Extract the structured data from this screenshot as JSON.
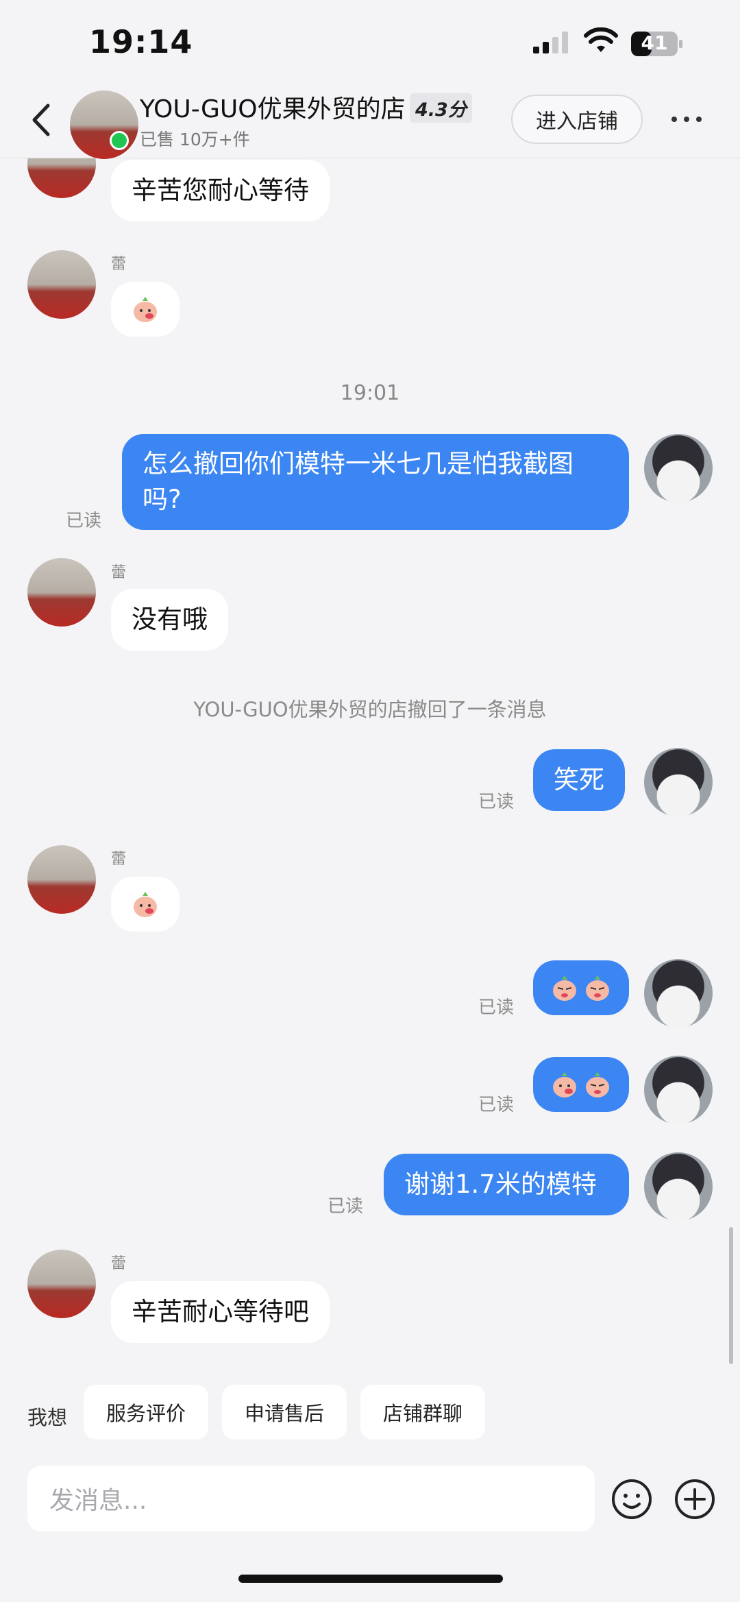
{
  "status": {
    "time": "19:14",
    "battery": "41"
  },
  "header": {
    "shop_name": "YOU-GUO优果外贸的店",
    "rating": "4.3分",
    "sold": "已售 10万+件",
    "enter_store": "进入店铺"
  },
  "messages": {
    "m1_text": "辛苦您耐心等待",
    "sender_name": "蕾",
    "time_1901": "19:01",
    "m3_text": "怎么撤回你们模特一米七几是怕我截图吗?",
    "m4_text": "没有哦",
    "recall_note": "YOU-GUO优果外贸的店撤回了一条消息",
    "m5_text": "笑死",
    "m8_text": "谢谢1.7米的模特",
    "m9_text": "辛苦耐心等待吧",
    "read_label": "已读"
  },
  "quick_actions": {
    "label": "我想",
    "items": [
      "服务评价",
      "申请售后",
      "店铺群聊"
    ]
  },
  "input": {
    "placeholder": "发消息..."
  },
  "colors": {
    "out_bubble": "#3b86f2",
    "in_bubble": "#ffffff",
    "background": "#f4f4f6",
    "online": "#1fc654"
  }
}
